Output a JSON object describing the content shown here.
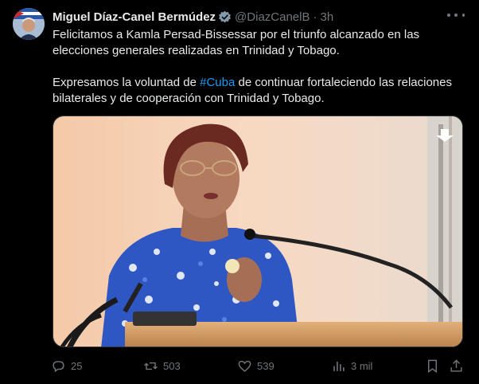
{
  "author": {
    "name": "Miguel Díaz-Canel Bermúdez",
    "handle": "@DiazCanelB",
    "separator": "·",
    "time": "3h"
  },
  "tweet": {
    "line1": "Felicitamos a Kamla Persad-Bissessar por el triunfo alcanzado en las elecciones generales realizadas en Trinidad y Tobago.",
    "line2_before": "Expresamos la voluntad de ",
    "hashtag": "#Cuba",
    "line2_after": " de continuar fortaleciendo las relaciones bilaterales y de cooperación con Trinidad y Tobago."
  },
  "stats": {
    "replies": "25",
    "retweets": "503",
    "likes": "539",
    "views": "3 mil"
  },
  "colors": {
    "background": "#000000",
    "text": "#e7e9ea",
    "muted": "#71767b",
    "link": "#1d9bf0",
    "verified": "#829aab"
  },
  "icons": {
    "verified": "verified-badge-icon",
    "more": "more-icon",
    "reply": "reply-icon",
    "retweet": "retweet-icon",
    "like": "heart-icon",
    "views": "views-icon",
    "bookmark": "bookmark-icon",
    "share": "share-icon"
  }
}
